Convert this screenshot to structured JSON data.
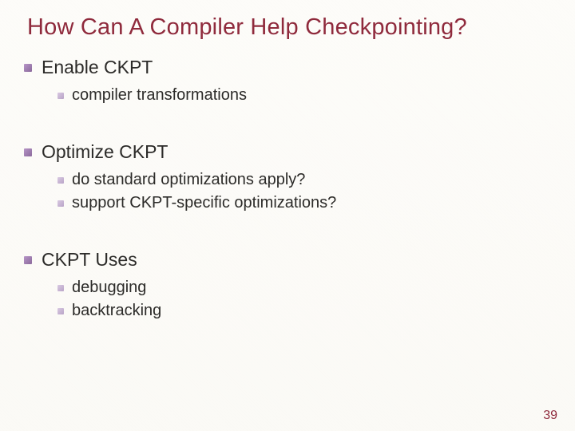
{
  "title": "How Can A Compiler Help Checkpointing?",
  "sections": [
    {
      "heading": "Enable CKPT",
      "items": [
        "compiler transformations"
      ]
    },
    {
      "heading": "Optimize CKPT",
      "items": [
        "do standard optimizations apply?",
        "support CKPT-specific optimizations?"
      ]
    },
    {
      "heading": "CKPT Uses",
      "items": [
        "debugging",
        "backtracking"
      ]
    }
  ],
  "page_number": "39"
}
